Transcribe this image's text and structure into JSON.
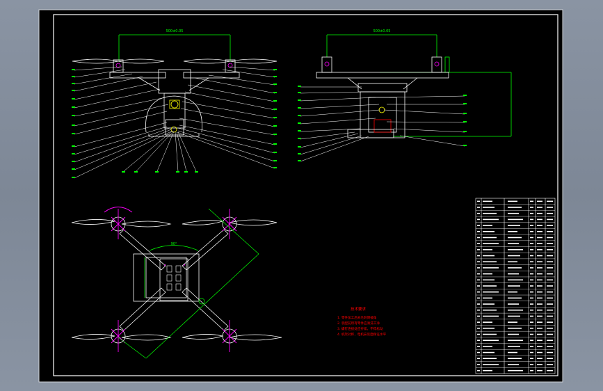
{
  "viewer": {
    "background": "#7f8998",
    "sheet_color": "#000000",
    "frame_color": "#ffffff",
    "accent_colors": {
      "leader": "#00ff00",
      "dimension": "#00ff00",
      "motor": "#ff00ff",
      "hub": "#ffff00",
      "notes": "#ff0000",
      "table": "#ffffff"
    }
  },
  "drawing": {
    "front_view": {
      "dimension_text": "500±0.05"
    },
    "side_view": {
      "dimension_text": "500±0.05"
    },
    "top_view": {
      "arm_dimension": "",
      "angle_label": "90°",
      "body_dimension": ""
    },
    "technical_notes": {
      "title": "技术要求",
      "lines": [
        "1. 零件加工后去毛刺倒棱角",
        "2. 装配前所有零件应清洗干净",
        "3. 螺钉连接处应拧紧，不得松动",
        "4. 机架对称，电机安装面保证水平"
      ]
    },
    "parts_table": {
      "row_count": 29
    }
  }
}
